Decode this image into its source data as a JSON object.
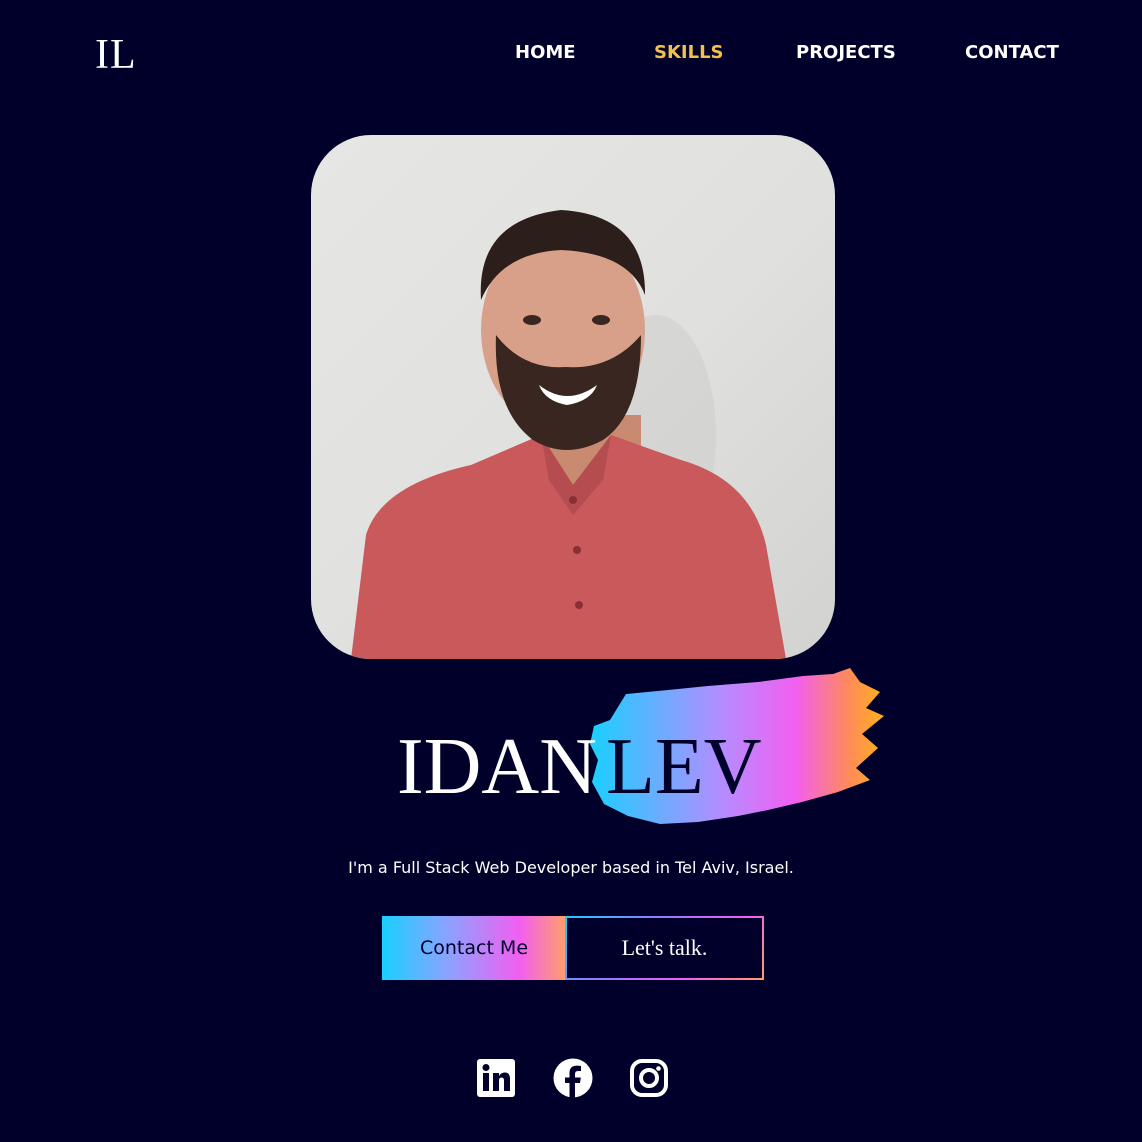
{
  "brand": {
    "logo_text": "IL"
  },
  "nav": {
    "items": [
      {
        "label": "HOME",
        "active": false
      },
      {
        "label": "SKILLS",
        "active": true
      },
      {
        "label": "PROJECTS",
        "active": false
      },
      {
        "label": "CONTACT",
        "active": false
      }
    ],
    "active_color": "#f2c04d"
  },
  "hero": {
    "photo_icon": "portrait-photo",
    "first_name": "IDAN",
    "last_name": "LEV",
    "tagline": "I'm a Full Stack Web Developer based in Tel Aviv, Israel.",
    "primary_button": "Contact Me",
    "secondary_button": "Let's talk."
  },
  "social": [
    {
      "icon": "linkedin-icon"
    },
    {
      "icon": "facebook-icon"
    },
    {
      "icon": "instagram-icon"
    }
  ],
  "colors": {
    "background": "#01002a",
    "gradient": [
      "#19d0ff",
      "#f25ff0",
      "#ff9f6a",
      "#ffb21a"
    ]
  }
}
